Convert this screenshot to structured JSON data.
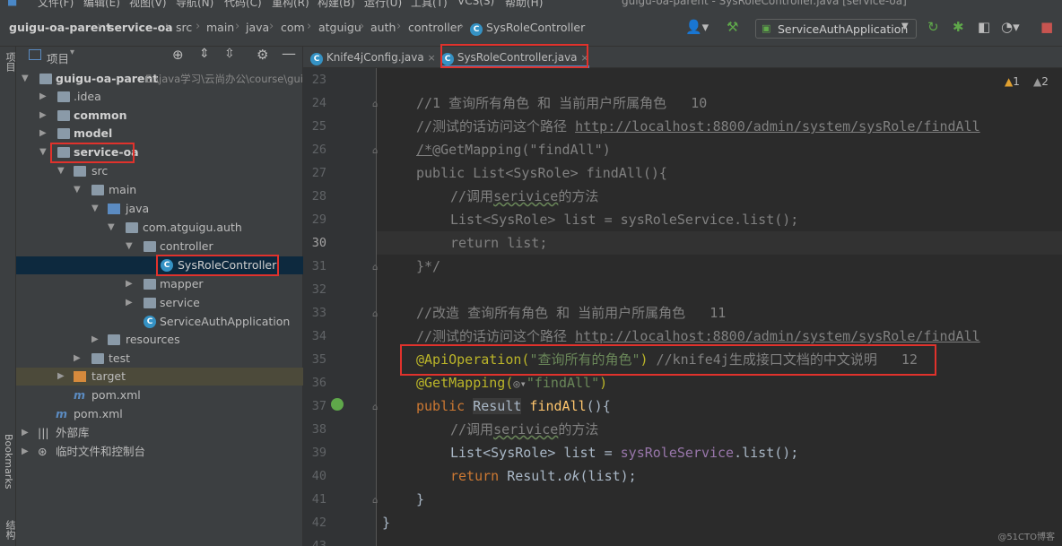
{
  "menubar": {
    "items": [
      "文件(F)",
      "编辑(E)",
      "视图(V)",
      "导航(N)",
      "代码(C)",
      "重构(R)",
      "构建(B)",
      "运行(U)",
      "工具(T)",
      "VCS(S)",
      "帮助(H)"
    ],
    "title": "guigu-oa-parent - SysRoleController.java [service-oa]"
  },
  "breadcrumbs": [
    "guigu-oa-parent",
    "service-oa",
    "src",
    "main",
    "java",
    "com",
    "atguigu",
    "auth",
    "controller",
    "SysRoleController"
  ],
  "toolbar": {
    "run_config": "ServiceAuthApplication",
    "icons": [
      "user-icon",
      "hammer-icon",
      "rerun-icon",
      "debug-bug-icon",
      "coverage-icon",
      "profile-icon",
      "more-run-icon",
      "stop-icon"
    ]
  },
  "left_strip": {
    "top_label": "项目",
    "bookmarks_label": "Bookmarks",
    "structure_label": "结构"
  },
  "project_panel": {
    "title": "项目",
    "tree": [
      {
        "label": "guigu-oa-parent",
        "extra": "E:\\java学习\\云尚办公\\course\\guig",
        "bold": true
      },
      {
        "label": ".idea"
      },
      {
        "label": "common",
        "bold": true
      },
      {
        "label": "model",
        "bold": true
      },
      {
        "label": "service-oa",
        "bold": true
      },
      {
        "label": "src"
      },
      {
        "label": "main"
      },
      {
        "label": "java"
      },
      {
        "label": "com.atguigu.auth"
      },
      {
        "label": "controller"
      },
      {
        "label": "SysRoleController"
      },
      {
        "label": "mapper"
      },
      {
        "label": "service"
      },
      {
        "label": "ServiceAuthApplication"
      },
      {
        "label": "resources"
      },
      {
        "label": "test"
      },
      {
        "label": "target"
      },
      {
        "label": "pom.xml"
      },
      {
        "label": "pom.xml"
      },
      {
        "label": "外部库"
      },
      {
        "label": "临时文件和控制台"
      }
    ]
  },
  "tabs": [
    {
      "label": "Knife4jConfig.java",
      "active": false
    },
    {
      "label": "SysRoleController.java",
      "active": true
    }
  ],
  "editor": {
    "warnings": {
      "warn_count": "1",
      "weak_warn_count": "2"
    },
    "line_numbers": [
      "23",
      "24",
      "25",
      "26",
      "27",
      "28",
      "29",
      "30",
      "31",
      "32",
      "33",
      "34",
      "35",
      "36",
      "37",
      "38",
      "39",
      "40",
      "41",
      "42",
      "43"
    ],
    "current_line": "30",
    "code": {
      "l24_comment": "//1 查询所有角色 和 当前用户所属角色   10",
      "l25_prefix": "//测试的话访问这个路径 ",
      "l25_url": "http://localhost:8800/admin/system/sysRole/findAll",
      "l26_open": "/*",
      "l26_rest": "@GetMapping(\"findAll\")",
      "l27_kw": "public ",
      "l27_rest": "List<SysRole> findAll(){",
      "l28_a": "//调用",
      "l28_b": "serivice",
      "l28_c": "的方法",
      "l29": "List<SysRole> list = sysRoleService.list();",
      "l30": "return list;",
      "l31": "}*/",
      "l33_comment": "//改造 查询所有角色 和 当前用户所属角色   11",
      "l34_prefix": "//测试的话访问这个路径 ",
      "l34_url": "http://localhost:8800/admin/system/sysRole/findAll",
      "l35_ann": "@ApiOperation(",
      "l35_str": "\"查询所有的角色\"",
      "l35_close": ")",
      "l35_comment": " //knife4j生成接口文档的中文说明   12",
      "l36_ann": "@GetMapping(",
      "l36_str": "\"findAll\"",
      "l36_close": ")",
      "l37_kw": "public ",
      "l37_type": "Result",
      "l37_fn": " findAll",
      "l37_rest": "(){",
      "l38_a": "//调用",
      "l38_b": "serivice",
      "l38_c": "的方法",
      "l39_a": "List<SysRole> list = ",
      "l39_fld": "sysRoleService",
      "l39_b": ".list();",
      "l40_kw": "return ",
      "l40_a": "Result.",
      "l40_it": "ok",
      "l40_b": "(list);",
      "l41": "}",
      "l42": "}"
    }
  },
  "watermark": "@51CTO博客"
}
